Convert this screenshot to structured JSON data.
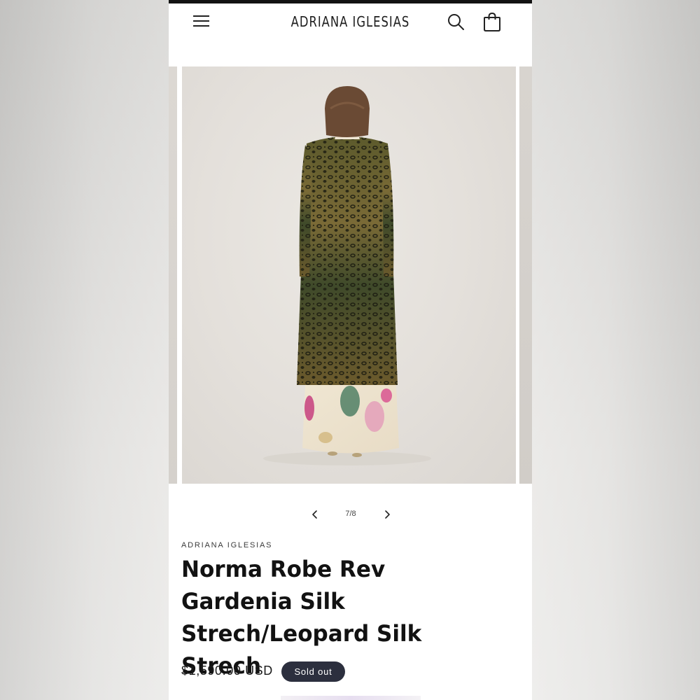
{
  "header": {
    "brand": "ADRIANA IGLESIAS",
    "menu_icon": "hamburger-menu-icon",
    "search_icon": "search-icon",
    "cart_icon": "shopping-bag-icon"
  },
  "gallery": {
    "counter": "7/8",
    "prev_icon": "chevron-left-icon",
    "next_icon": "chevron-right-icon",
    "current_index": 7,
    "total": 8
  },
  "product": {
    "vendor": "ADRIANA IGLESIAS",
    "title": "Norma Robe Rev Gardenia Silk Strech/Leopard Silk Strech",
    "price": "$1,590.00 USD",
    "badge": "Sold out"
  },
  "colors": {
    "badge_bg": "#2c2f3e",
    "text": "#121212",
    "top_bar": "#121212"
  }
}
